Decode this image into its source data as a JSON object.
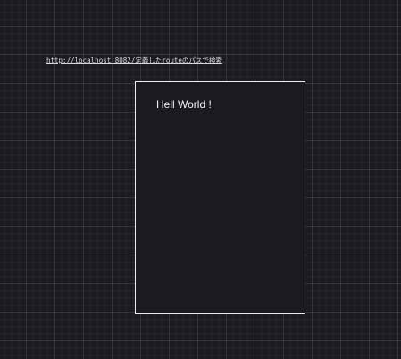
{
  "search_hint": {
    "url_text": "http://localhost:8082/定義したrouteのパスで検索"
  },
  "preview": {
    "text": "Hell World !"
  },
  "colors": {
    "background": "#1c1b22",
    "grid_line": "#3a3940",
    "frame_border": "#ececef",
    "text": "#f3f3f5"
  }
}
